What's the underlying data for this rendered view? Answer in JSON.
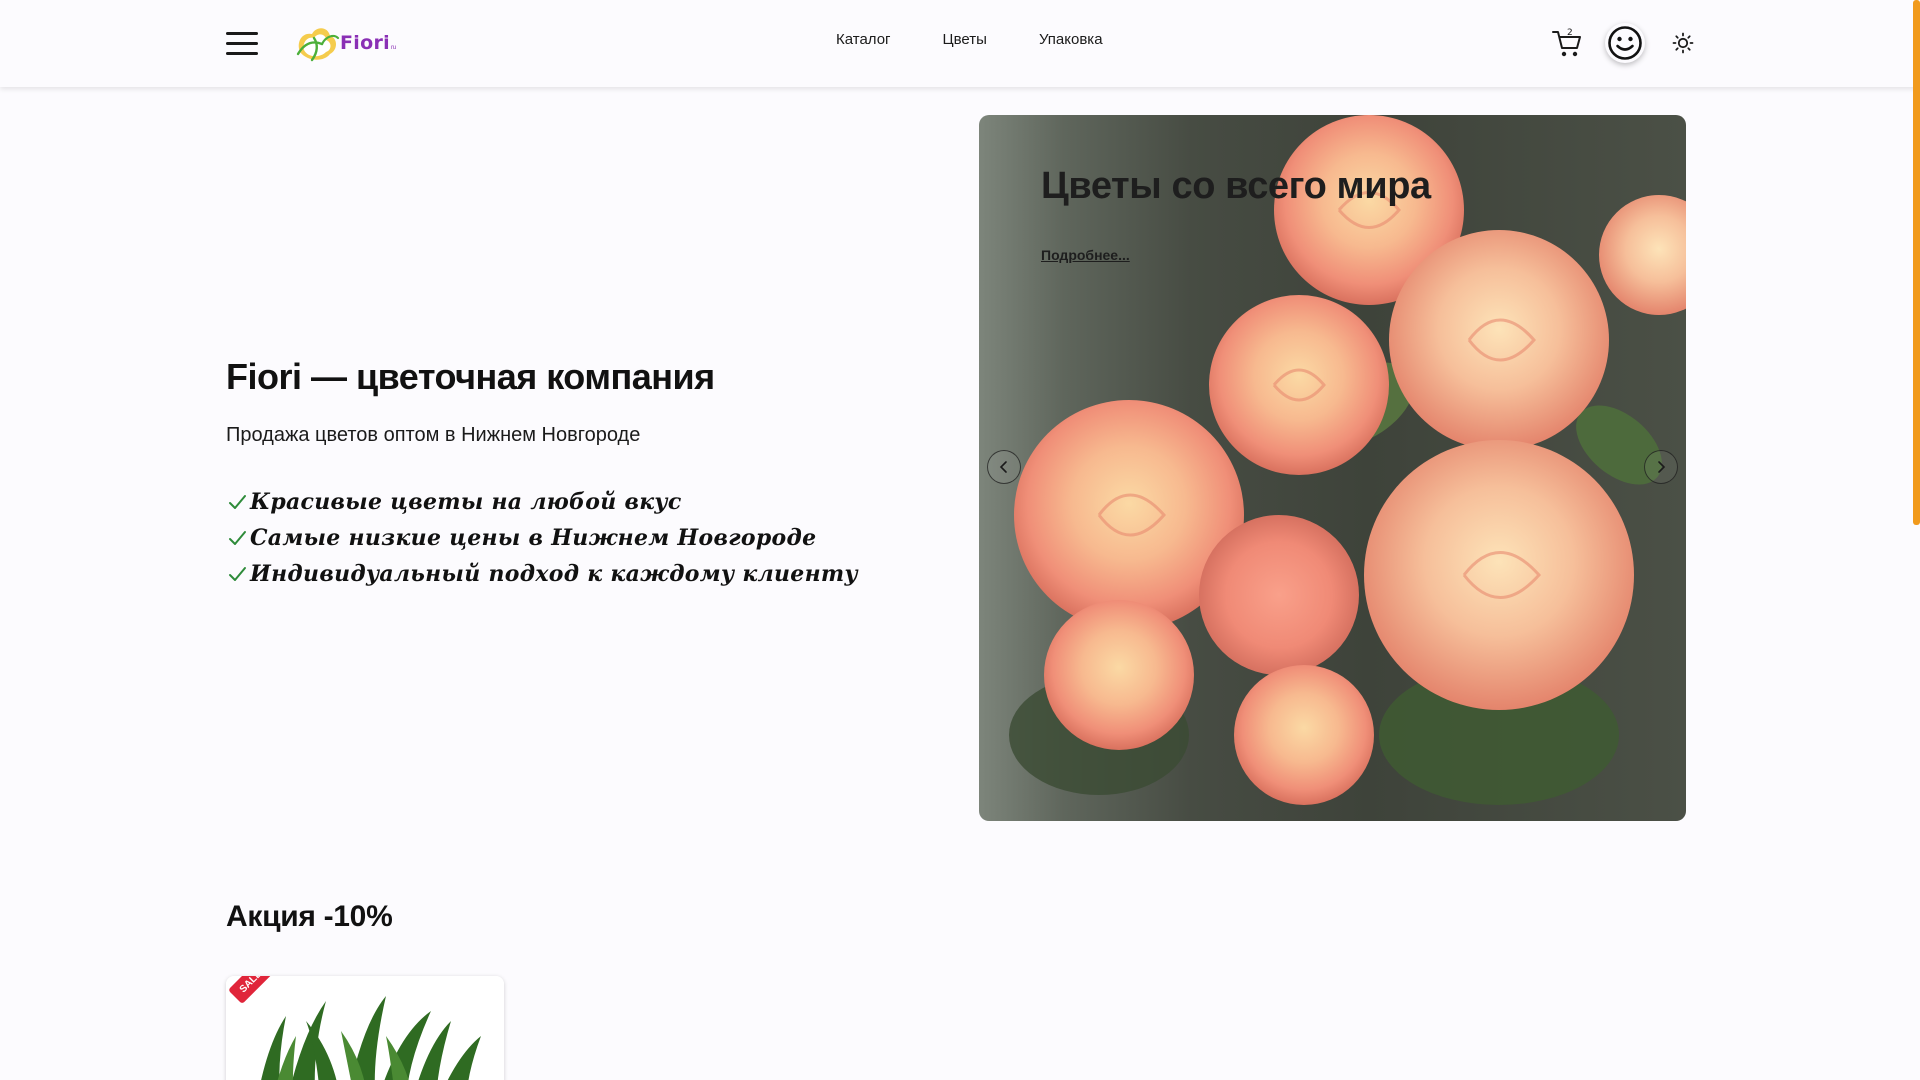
{
  "header": {
    "logo_text": "Fiori",
    "logo_suffix": "ru",
    "nav": [
      "Каталог",
      "Цветы",
      "Упаковка"
    ],
    "cart_badge": "2"
  },
  "hero": {
    "title": "Fiori — цветочная компания",
    "subtitle": "Продажа цветов оптом в Нижнем Новгороде",
    "features": [
      "Красивые цветы на любой вкус",
      "Самые низкие цены в Нижнем Новгороде",
      "Индивидуальный подход к каждому клиенту"
    ]
  },
  "slider": {
    "title": "Цветы со всего мира",
    "link": "Подробнее...",
    "prev_symbol": "‹",
    "next_symbol": "›"
  },
  "sale": {
    "heading": "Акция -10%",
    "badge": "SALE"
  },
  "colors": {
    "accent": "#8a2fb5",
    "scrollbar": "#f19a1c",
    "check": "#2e8b3a",
    "sale_badge": "#e0253a"
  },
  "icons": [
    "menu-icon",
    "cart-icon",
    "smiley-profile-icon",
    "sun-theme-icon",
    "check-icon",
    "chevron-left-icon",
    "chevron-right-icon"
  ]
}
